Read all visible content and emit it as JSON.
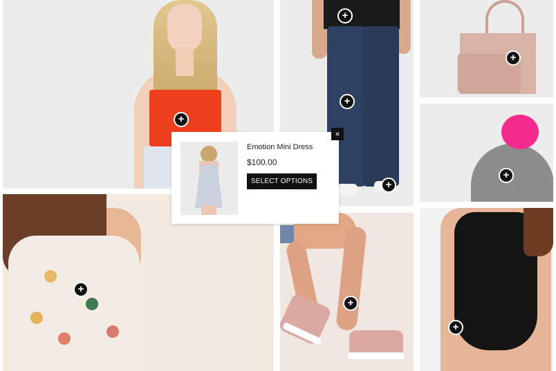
{
  "hotspot_symbol": "+",
  "popup": {
    "product_name": "Emotion Mini Dress",
    "price": "$100.00",
    "button_label": "SELECT OPTIONS",
    "close_symbol": "×"
  },
  "tiles": [
    {
      "name": "red crop top",
      "icon": "plus-icon"
    },
    {
      "name": "jeans",
      "icon": "plus-icon"
    },
    {
      "name": "handbag",
      "icon": "plus-icon"
    },
    {
      "name": "beanie",
      "icon": "plus-icon"
    },
    {
      "name": "floral top",
      "icon": "plus-icon"
    },
    {
      "name": "sneakers",
      "icon": "plus-icon"
    },
    {
      "name": "bodysuit",
      "icon": "plus-icon"
    }
  ],
  "colors": {
    "hotspot": "#111111",
    "button": "#111111",
    "pompom": "#f42a8c",
    "red_top": "#ee3f1e"
  }
}
